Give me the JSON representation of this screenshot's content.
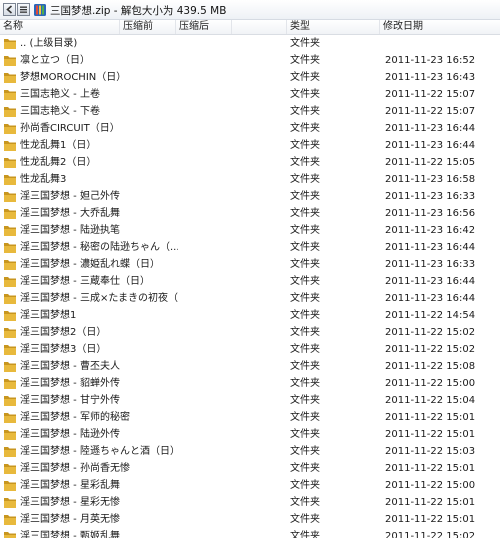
{
  "window": {
    "title": "三国梦想.zip - 解包大小为 439.5 MB"
  },
  "columns": {
    "name": "名称",
    "compressed_before": "压缩前",
    "compressed_after": "压缩后",
    "type": "类型",
    "modified": "修改日期"
  },
  "colors": {
    "folder": "#e8b93c",
    "folder_dark": "#c8961f",
    "header_border": "#d9dde3"
  },
  "files": [
    {
      "name": ".. (上级目录)",
      "type": "文件夹",
      "date": ""
    },
    {
      "name": "凛と立つ（日）",
      "type": "文件夹",
      "date": "2011-11-23 16:52"
    },
    {
      "name": "梦想MOROCHIN（日）",
      "type": "文件夹",
      "date": "2011-11-23 16:43"
    },
    {
      "name": "三国志艳义 - 上卷",
      "type": "文件夹",
      "date": "2011-11-22 15:07"
    },
    {
      "name": "三国志艳义 - 下卷",
      "type": "文件夹",
      "date": "2011-11-22 15:07"
    },
    {
      "name": "孙尚香CIRCUIT（日）",
      "type": "文件夹",
      "date": "2011-11-23 16:44"
    },
    {
      "name": "性龙乱舞1（日）",
      "type": "文件夹",
      "date": "2011-11-23 16:44"
    },
    {
      "name": "性龙乱舞2（日）",
      "type": "文件夹",
      "date": "2011-11-22 15:05"
    },
    {
      "name": "性龙乱舞3",
      "type": "文件夹",
      "date": "2011-11-23 16:58"
    },
    {
      "name": "淫三国梦想 - 妲己外传",
      "type": "文件夹",
      "date": "2011-11-23 16:33"
    },
    {
      "name": "淫三国梦想 - 大乔乱舞",
      "type": "文件夹",
      "date": "2011-11-23 16:56"
    },
    {
      "name": "淫三国梦想 - 陆逊执笔",
      "type": "文件夹",
      "date": "2011-11-23 16:42"
    },
    {
      "name": "淫三国梦想 - 秘密の陆逊ちゃん（...",
      "type": "文件夹",
      "date": "2011-11-23 16:44"
    },
    {
      "name": "淫三国梦想 - 濃姫乱れ蝶（日）",
      "type": "文件夹",
      "date": "2011-11-23 16:33"
    },
    {
      "name": "淫三国梦想 - 三蔵奉仕（日）",
      "type": "文件夹",
      "date": "2011-11-23 16:44"
    },
    {
      "name": "淫三国梦想 - 三成×たまきの初夜（...",
      "type": "文件夹",
      "date": "2011-11-23 16:44"
    },
    {
      "name": "淫三国梦想1",
      "type": "文件夹",
      "date": "2011-11-22 14:54"
    },
    {
      "name": "淫三国梦想2（日）",
      "type": "文件夹",
      "date": "2011-11-22 15:02"
    },
    {
      "name": "淫三国梦想3（日）",
      "type": "文件夹",
      "date": "2011-11-22 15:02"
    },
    {
      "name": "淫三国梦想 - 曹丕夫人",
      "type": "文件夹",
      "date": "2011-11-22 15:08"
    },
    {
      "name": "淫三国梦想 - 貂蝉外传",
      "type": "文件夹",
      "date": "2011-11-22 15:00"
    },
    {
      "name": "淫三国梦想 - 甘宁外传",
      "type": "文件夹",
      "date": "2011-11-22 15:04"
    },
    {
      "name": "淫三国梦想 - 军师的秘密",
      "type": "文件夹",
      "date": "2011-11-22 15:01"
    },
    {
      "name": "淫三国梦想 - 陆逊外传",
      "type": "文件夹",
      "date": "2011-11-22 15:01"
    },
    {
      "name": "淫三国梦想 - 陸遜ちゃんと酒（日）",
      "type": "文件夹",
      "date": "2011-11-22 15:03"
    },
    {
      "name": "淫三国梦想 - 孙尚香无惨",
      "type": "文件夹",
      "date": "2011-11-22 15:01"
    },
    {
      "name": "淫三国梦想 - 星彩乱舞",
      "type": "文件夹",
      "date": "2011-11-22 15:00"
    },
    {
      "name": "淫三国梦想 - 星彩无惨",
      "type": "文件夹",
      "date": "2011-11-22 15:01"
    },
    {
      "name": "淫三国梦想 - 月英无惨",
      "type": "文件夹",
      "date": "2011-11-22 15:01"
    },
    {
      "name": "淫三国梦想 - 甄姬乱舞",
      "type": "文件夹",
      "date": "2011-11-22 15:02"
    }
  ]
}
